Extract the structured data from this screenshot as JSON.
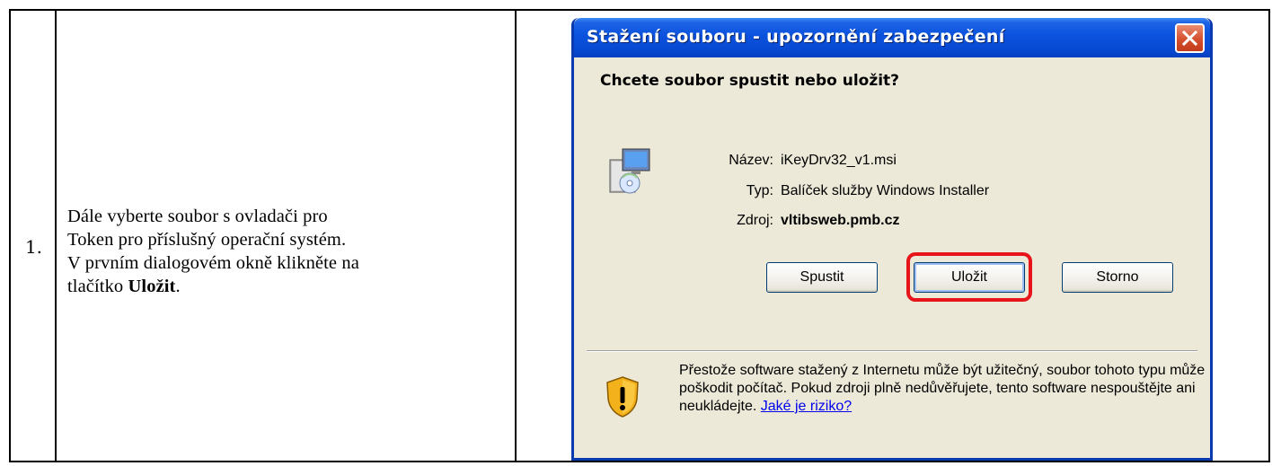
{
  "row": {
    "number": "1.",
    "instruction_lines": [
      "Dále vyberte soubor s ovladači pro",
      "Token pro příslušný operační systém.",
      "V prvním dialogovém okně klikněte na",
      "tlačítko"
    ],
    "instruction_bold": "Uložit",
    "instruction_end": "."
  },
  "dialog": {
    "title": "Stažení souboru - upozornění zabezpečení",
    "question": "Chcete soubor spustit nebo uložit?",
    "fields": {
      "name_label": "Název:",
      "name_value": "iKeyDrv32_v1.msi",
      "type_label": "Typ:",
      "type_value": "Balíček služby Windows Installer",
      "source_label": "Zdroj:",
      "source_value": "vltibsweb.pmb.cz"
    },
    "buttons": {
      "run": "Spustit",
      "save": "Uložit",
      "cancel": "Storno"
    },
    "warning": {
      "text": "Přestože software stažený z Internetu může být užitečný, soubor tohoto typu může poškodit počítač. Pokud zdroji plně nedůvěřujete, tento software nespouštějte ani neukládejte.",
      "link": "Jaké je riziko?"
    },
    "colors": {
      "titlebar": "#0a52dd",
      "highlight": "#e8141c",
      "close": "#d5502f"
    },
    "icons": [
      "close-icon",
      "installer-icon",
      "shield-warning-icon"
    ]
  }
}
